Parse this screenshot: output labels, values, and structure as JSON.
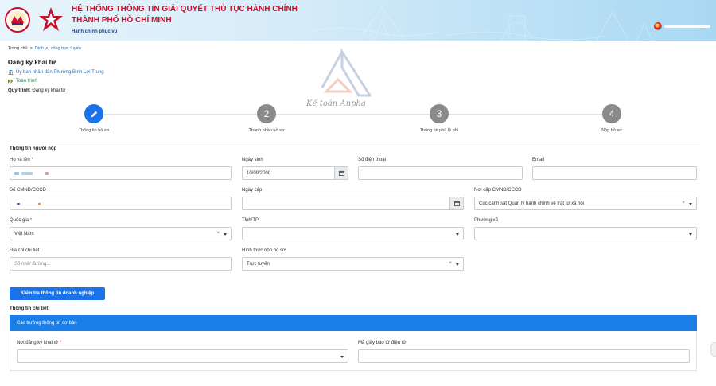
{
  "header": {
    "title_line1": "HỆ THỐNG THÔNG TIN GIẢI QUYẾT THỦ TỤC HÀNH CHÍNH",
    "title_line2": "THÀNH PHỐ HỒ CHÍ MINH",
    "subtitle": "Hành chính phục vụ"
  },
  "breadcrumb": {
    "home": "Trang chủ",
    "separator": ">",
    "current": "Dịch vụ công trực tuyến"
  },
  "page": {
    "title": "Đăng ký khai tử",
    "agency": "Ủy ban nhân dân Phường Bình Lợi Trung",
    "scope": "Toàn trình",
    "procedure_label": "Quy trình:",
    "procedure_value": "Đăng ký khai tử"
  },
  "watermark": {
    "text": "Kế toán Anpha"
  },
  "steps": [
    {
      "number": "",
      "label": "Thông tin hồ sơ"
    },
    {
      "number": "2",
      "label": "Thành phần hồ sơ"
    },
    {
      "number": "3",
      "label": "Thông tin phí, lệ phí"
    },
    {
      "number": "4",
      "label": "Nộp hồ sơ"
    }
  ],
  "form": {
    "section_applicant": "Thông tin người nộp",
    "full_name_label": "Họ và tên",
    "dob_label": "Ngày sinh",
    "dob_value": "10/09/2000",
    "phone_label": "Số điện thoại",
    "email_label": "Email",
    "id_label": "Số CMND/CCCD",
    "issue_date_label": "Ngày cấp",
    "issue_place_label": "Nơi cấp CMND/CCCD",
    "issue_place_value": "Cục cảnh sát Quản lý hành chính về trật tự xã hội",
    "country_label": "Quốc gia",
    "country_value": "Việt Nam",
    "province_label": "Tỉnh/TP",
    "ward_label": "Phường xã",
    "address_label": "Địa chỉ chi tiết",
    "address_placeholder": "Số nhà/ đường...",
    "method_label": "Hình thức nộp hồ sơ",
    "method_value": "Trực tuyến",
    "check_button": "Kiểm tra thông tin doanh nghiệp",
    "section_detail": "Thông tin chi tiết",
    "basic_fields_bar": "Các trường thông tin cơ bản",
    "register_place_label": "Nơi đăng ký khai tử",
    "death_notice_label": "Mã giấy báo tử điện tử",
    "required_mark": "*",
    "clear_mark": "×"
  },
  "colors": {
    "accent": "#1a73e8",
    "header_red": "#c8102e",
    "link": "#1a73c7"
  }
}
